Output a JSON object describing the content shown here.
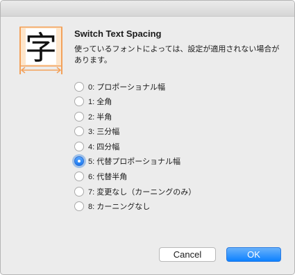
{
  "dialog": {
    "icon_glyph": "字",
    "icon_name": "text-spacing-icon",
    "title": "Switch Text Spacing",
    "description": "使っているフォントによっては、設定が適用されない場合があります。"
  },
  "options": [
    {
      "label": "0: プロポーショナル幅",
      "checked": false
    },
    {
      "label": "1: 全角",
      "checked": false
    },
    {
      "label": "2: 半角",
      "checked": false
    },
    {
      "label": "3: 三分幅",
      "checked": false
    },
    {
      "label": "4: 四分幅",
      "checked": false
    },
    {
      "label": "5: 代替プロポーショナル幅",
      "checked": true
    },
    {
      "label": "6: 代替半角",
      "checked": false
    },
    {
      "label": "7: 変更なし（カーニングのみ）",
      "checked": false
    },
    {
      "label": "8: カーニングなし",
      "checked": false
    }
  ],
  "buttons": {
    "cancel_label": "Cancel",
    "ok_label": "OK"
  },
  "colors": {
    "accent": "#1a78f0",
    "icon_orange": "#f3a15a",
    "window_bg": "#ececec"
  }
}
